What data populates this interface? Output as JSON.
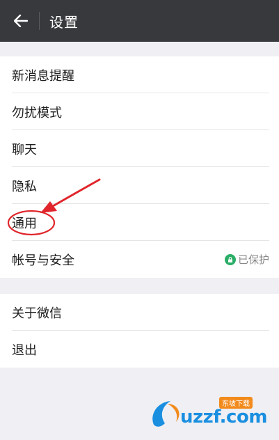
{
  "header": {
    "title": "设置",
    "back_icon": "back-arrow-icon"
  },
  "settings_group_1": [
    {
      "label": "新消息提醒"
    },
    {
      "label": "勿扰模式"
    },
    {
      "label": "聊天"
    },
    {
      "label": "隐私"
    },
    {
      "label": "通用"
    },
    {
      "label": "帐号与安全",
      "status": "已保护",
      "status_icon": "lock-icon"
    }
  ],
  "settings_group_2": [
    {
      "label": "关于微信"
    },
    {
      "label": "退出"
    }
  ],
  "watermark": {
    "text": "uzzf.com",
    "badge": "东坡下载"
  },
  "colors": {
    "header_bg": "#38393d",
    "annotation_red": "#e0262c",
    "protected_green": "#2aae67"
  }
}
